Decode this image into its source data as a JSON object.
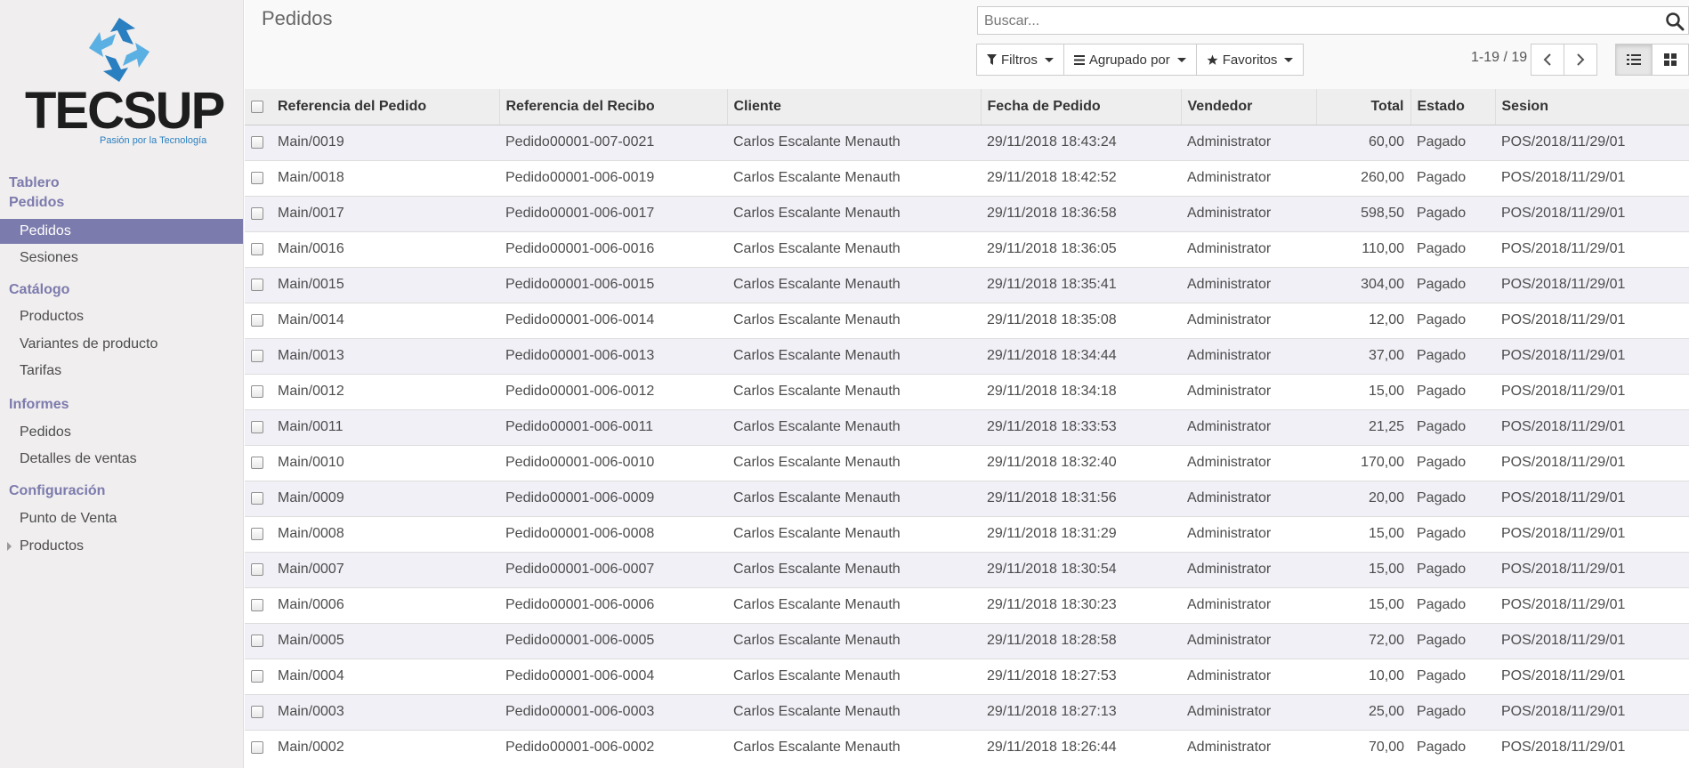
{
  "logo": {
    "text": "TECSUP",
    "tagline": "Pasión por la Tecnología"
  },
  "sidebar": {
    "sections": [
      {
        "label": "Tablero",
        "items": []
      },
      {
        "label": "Pedidos",
        "items": [
          {
            "label": "Pedidos",
            "active": true
          },
          {
            "label": "Sesiones"
          }
        ]
      },
      {
        "label": "Catálogo",
        "items": [
          {
            "label": "Productos"
          },
          {
            "label": "Variantes de producto"
          },
          {
            "label": "Tarifas"
          }
        ]
      },
      {
        "label": "Informes",
        "items": [
          {
            "label": "Pedidos"
          },
          {
            "label": "Detalles de ventas"
          }
        ]
      },
      {
        "label": "Configuración",
        "items": [
          {
            "label": "Punto de Venta"
          },
          {
            "label": "Productos",
            "expandable": true
          }
        ]
      }
    ]
  },
  "header": {
    "title": "Pedidos",
    "search_placeholder": "Buscar...",
    "filters_label": "Filtros",
    "groupby_label": "Agrupado por",
    "favorites_label": "Favoritos",
    "pager": "1-19 / 19"
  },
  "table": {
    "columns": [
      "Referencia del Pedido",
      "Referencia del Recibo",
      "Cliente",
      "Fecha de Pedido",
      "Vendedor",
      "Total",
      "Estado",
      "Sesion"
    ],
    "rows": [
      [
        "Main/0019",
        "Pedido00001-007-0021",
        "Carlos Escalante Menauth",
        "29/11/2018 18:43:24",
        "Administrator",
        "60,00",
        "Pagado",
        "POS/2018/11/29/01"
      ],
      [
        "Main/0018",
        "Pedido00001-006-0019",
        "Carlos Escalante Menauth",
        "29/11/2018 18:42:52",
        "Administrator",
        "260,00",
        "Pagado",
        "POS/2018/11/29/01"
      ],
      [
        "Main/0017",
        "Pedido00001-006-0017",
        "Carlos Escalante Menauth",
        "29/11/2018 18:36:58",
        "Administrator",
        "598,50",
        "Pagado",
        "POS/2018/11/29/01"
      ],
      [
        "Main/0016",
        "Pedido00001-006-0016",
        "Carlos Escalante Menauth",
        "29/11/2018 18:36:05",
        "Administrator",
        "110,00",
        "Pagado",
        "POS/2018/11/29/01"
      ],
      [
        "Main/0015",
        "Pedido00001-006-0015",
        "Carlos Escalante Menauth",
        "29/11/2018 18:35:41",
        "Administrator",
        "304,00",
        "Pagado",
        "POS/2018/11/29/01"
      ],
      [
        "Main/0014",
        "Pedido00001-006-0014",
        "Carlos Escalante Menauth",
        "29/11/2018 18:35:08",
        "Administrator",
        "12,00",
        "Pagado",
        "POS/2018/11/29/01"
      ],
      [
        "Main/0013",
        "Pedido00001-006-0013",
        "Carlos Escalante Menauth",
        "29/11/2018 18:34:44",
        "Administrator",
        "37,00",
        "Pagado",
        "POS/2018/11/29/01"
      ],
      [
        "Main/0012",
        "Pedido00001-006-0012",
        "Carlos Escalante Menauth",
        "29/11/2018 18:34:18",
        "Administrator",
        "15,00",
        "Pagado",
        "POS/2018/11/29/01"
      ],
      [
        "Main/0011",
        "Pedido00001-006-0011",
        "Carlos Escalante Menauth",
        "29/11/2018 18:33:53",
        "Administrator",
        "21,25",
        "Pagado",
        "POS/2018/11/29/01"
      ],
      [
        "Main/0010",
        "Pedido00001-006-0010",
        "Carlos Escalante Menauth",
        "29/11/2018 18:32:40",
        "Administrator",
        "170,00",
        "Pagado",
        "POS/2018/11/29/01"
      ],
      [
        "Main/0009",
        "Pedido00001-006-0009",
        "Carlos Escalante Menauth",
        "29/11/2018 18:31:56",
        "Administrator",
        "20,00",
        "Pagado",
        "POS/2018/11/29/01"
      ],
      [
        "Main/0008",
        "Pedido00001-006-0008",
        "Carlos Escalante Menauth",
        "29/11/2018 18:31:29",
        "Administrator",
        "15,00",
        "Pagado",
        "POS/2018/11/29/01"
      ],
      [
        "Main/0007",
        "Pedido00001-006-0007",
        "Carlos Escalante Menauth",
        "29/11/2018 18:30:54",
        "Administrator",
        "15,00",
        "Pagado",
        "POS/2018/11/29/01"
      ],
      [
        "Main/0006",
        "Pedido00001-006-0006",
        "Carlos Escalante Menauth",
        "29/11/2018 18:30:23",
        "Administrator",
        "15,00",
        "Pagado",
        "POS/2018/11/29/01"
      ],
      [
        "Main/0005",
        "Pedido00001-006-0005",
        "Carlos Escalante Menauth",
        "29/11/2018 18:28:58",
        "Administrator",
        "72,00",
        "Pagado",
        "POS/2018/11/29/01"
      ],
      [
        "Main/0004",
        "Pedido00001-006-0004",
        "Carlos Escalante Menauth",
        "29/11/2018 18:27:53",
        "Administrator",
        "10,00",
        "Pagado",
        "POS/2018/11/29/01"
      ],
      [
        "Main/0003",
        "Pedido00001-006-0003",
        "Carlos Escalante Menauth",
        "29/11/2018 18:27:13",
        "Administrator",
        "25,00",
        "Pagado",
        "POS/2018/11/29/01"
      ],
      [
        "Main/0002",
        "Pedido00001-006-0002",
        "Carlos Escalante Menauth",
        "29/11/2018 18:26:44",
        "Administrator",
        "70,00",
        "Pagado",
        "POS/2018/11/29/01"
      ]
    ]
  },
  "colors": {
    "accent": "#7c7bad",
    "row_alt": "#f0f0f6",
    "logo_blue": "#2a7fc0"
  },
  "icons": {
    "search": "search-icon",
    "list_view": "list-view-icon",
    "kanban_view": "kanban-view-icon",
    "filter": "filter-icon",
    "star": "star-icon"
  }
}
